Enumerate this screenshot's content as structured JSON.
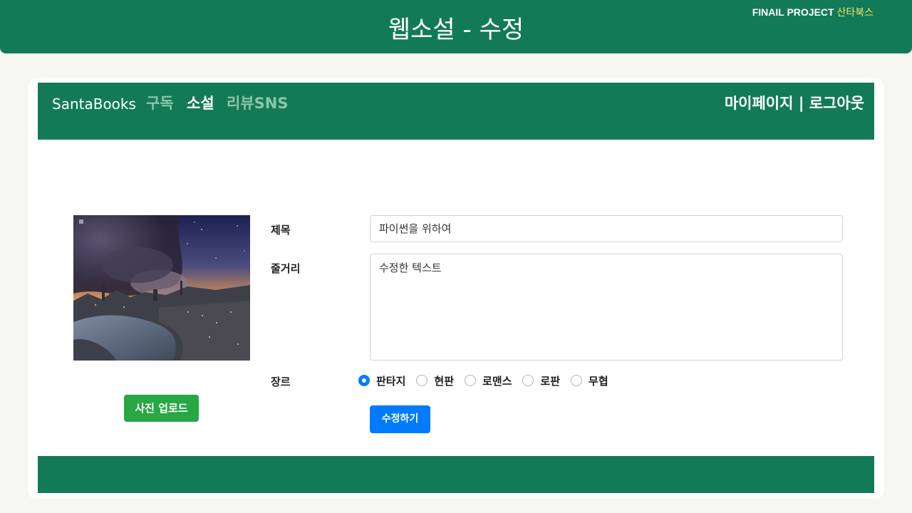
{
  "banner": {
    "title": "웹소설 - 수정",
    "brand_prefix": "FINAIL PROJECT",
    "brand_name": "산타북스"
  },
  "navbar": {
    "brand": "SantaBooks",
    "links": [
      "구독",
      "소설",
      "리뷰SNS"
    ],
    "active_link": "소설",
    "mypage": "마이페이지",
    "separator": " | ",
    "logout": "로그아웃"
  },
  "form": {
    "title_label": "제목",
    "title_value": "파이썬을 위하여",
    "plot_label": "줄거리",
    "plot_value": "수정한 텍스트",
    "genre_label": "장르",
    "genres": [
      "판타지",
      "현판",
      "로맨스",
      "로판",
      "무협"
    ],
    "selected_genre": "판타지",
    "submit_label": "수정하기",
    "upload_label": "사진 업로드"
  },
  "colors": {
    "primary_green": "#137a57",
    "accent_yellow": "#f3e36a",
    "button_blue": "#007bff",
    "button_green": "#28a745"
  }
}
